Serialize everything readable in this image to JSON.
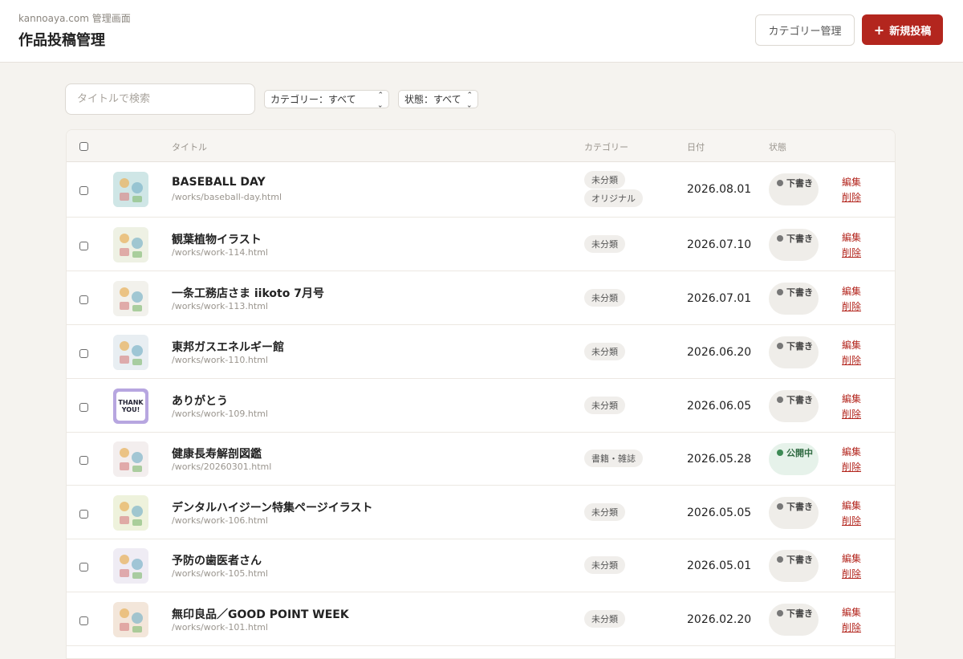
{
  "header": {
    "site_name": "kannoaya.com 管理画面",
    "page_title": "作品投稿管理",
    "category_button": "カテゴリー管理",
    "new_post_button": "新規投稿",
    "new_post_icon": "plus-icon"
  },
  "filters": {
    "search_placeholder": "タイトルで検索",
    "search_value": "",
    "category_select": "カテゴリー：すべて",
    "status_select": "状態：すべて"
  },
  "table": {
    "headers": {
      "title": "タイトル",
      "category": "カテゴリー",
      "date": "日付",
      "status": "状態"
    },
    "rows": [
      {
        "title": "BASEBALL DAY",
        "path": "/works/baseball-day.html",
        "tags": [
          "未分類",
          "オリジナル"
        ],
        "date": "2026.08.01",
        "status": "下書き",
        "status_type": "draft",
        "edit": "編集",
        "delete": "削除",
        "thumb_color": "#cfe6e6"
      },
      {
        "title": "観葉植物イラスト",
        "path": "/works/work-114.html",
        "tags": [
          "未分類"
        ],
        "date": "2026.07.10",
        "status": "下書き",
        "status_type": "draft",
        "edit": "編集",
        "delete": "削除",
        "thumb_color": "#eef1e4"
      },
      {
        "title": "一条工務店さま iikoto 7月号",
        "path": "/works/work-113.html",
        "tags": [
          "未分類"
        ],
        "date": "2026.07.01",
        "status": "下書き",
        "status_type": "draft",
        "edit": "編集",
        "delete": "削除",
        "thumb_color": "#f2f1ec"
      },
      {
        "title": "東邦ガスエネルギー館",
        "path": "/works/work-110.html",
        "tags": [
          "未分類"
        ],
        "date": "2026.06.20",
        "status": "下書き",
        "status_type": "draft",
        "edit": "編集",
        "delete": "削除",
        "thumb_color": "#e8eef2"
      },
      {
        "title": "ありがとう",
        "path": "/works/work-109.html",
        "tags": [
          "未分類"
        ],
        "date": "2026.06.05",
        "status": "下書き",
        "status_type": "draft",
        "edit": "編集",
        "delete": "削除",
        "thumb_color": "#b7a6e0",
        "thumb_text": "THANK YOU!"
      },
      {
        "title": "健康長寿解剖図鑑",
        "path": "/works/20260301.html",
        "tags": [
          "書籍・雑誌"
        ],
        "date": "2026.05.28",
        "status": "公開中",
        "status_type": "published",
        "edit": "編集",
        "delete": "削除",
        "thumb_color": "#f3eeee"
      },
      {
        "title": "デンタルハイジーン特集ページイラスト",
        "path": "/works/work-106.html",
        "tags": [
          "未分類"
        ],
        "date": "2026.05.05",
        "status": "下書き",
        "status_type": "draft",
        "edit": "編集",
        "delete": "削除",
        "thumb_color": "#eef2dc"
      },
      {
        "title": "予防の歯医者さん",
        "path": "/works/work-105.html",
        "tags": [
          "未分類"
        ],
        "date": "2026.05.01",
        "status": "下書き",
        "status_type": "draft",
        "edit": "編集",
        "delete": "削除",
        "thumb_color": "#efecf4"
      },
      {
        "title": "無印良品／GOOD POINT WEEK",
        "path": "/works/work-101.html",
        "tags": [
          "未分類"
        ],
        "date": "2026.02.20",
        "status": "下書き",
        "status_type": "draft",
        "edit": "編集",
        "delete": "削除",
        "thumb_color": "#f3e6da"
      }
    ]
  },
  "colors": {
    "accent": "#b3261e",
    "draft_badge": "#efede9",
    "published_badge": "#e6f2ea",
    "published_dot": "#3d8a55"
  }
}
